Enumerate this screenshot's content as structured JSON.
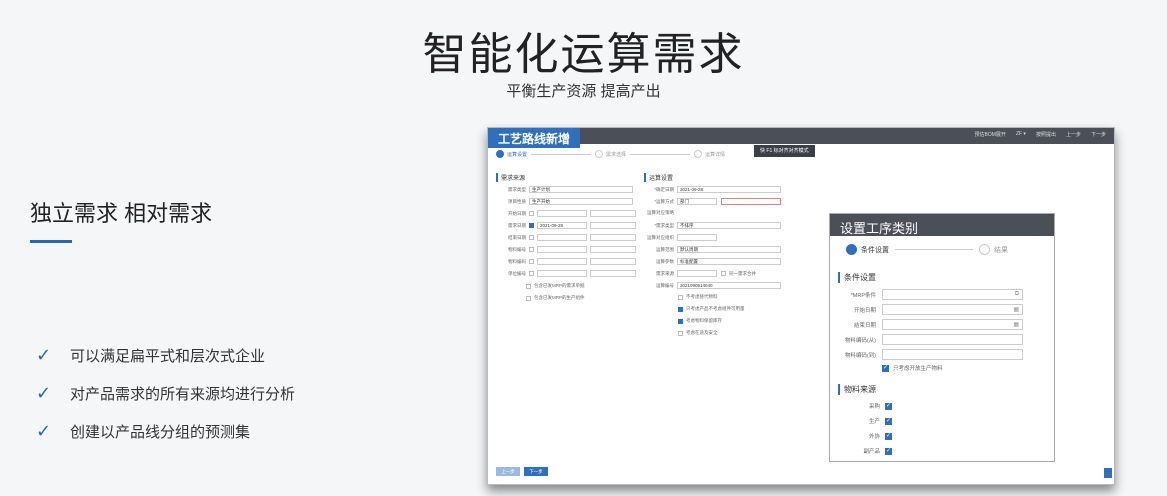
{
  "hero": {
    "title": "智能化运算需求",
    "subtitle": "平衡生产资源 提高产出"
  },
  "left": {
    "heading": "独立需求 相对需求",
    "features": [
      "可以满足扁平式和层次式企业",
      "对产品需求的所有来源均进行分析",
      "创建以产品线分组的预测集"
    ]
  },
  "app": {
    "title": "工艺路线新增",
    "topbar": [
      "预估BOM展开",
      "ZF ▾",
      "按照提出",
      "上一步",
      "下一步"
    ],
    "mode_popup": "快  F1  标对齐对齐模式",
    "steps": [
      "运算设置",
      "需求选择",
      "运算详情"
    ],
    "left_section": "需求来源",
    "left_fields": [
      {
        "label": "需求类型",
        "value": "生产计划"
      },
      {
        "label": "项目性质",
        "value": "生产开始"
      },
      {
        "label": "开始日期",
        "value": ""
      },
      {
        "label": "需求日期",
        "value": "2021-09-28"
      },
      {
        "label": "结束日期",
        "value": ""
      },
      {
        "label": "物料编号",
        "value": ""
      },
      {
        "label": "物料编码",
        "value": ""
      },
      {
        "label": "单位编号",
        "value": ""
      }
    ],
    "left_checks": [
      "包含已发MRP的需求单据",
      "包含已发MRP的生产组件"
    ],
    "right_section": "运算设置",
    "right_fields": [
      {
        "label": "*确定日期",
        "value": "2021-09-28"
      },
      {
        "label": "*运算方式",
        "value": "部门"
      },
      {
        "label": "运算对应策略",
        "value": ""
      },
      {
        "label": "*需求类型",
        "value": "不排序"
      },
      {
        "label": "运算对应组织",
        "value": ""
      },
      {
        "label": "运算范围",
        "value": "默认周期"
      },
      {
        "label": "运算参数",
        "value": "标准配置"
      },
      {
        "label": "需求来源",
        "value": ""
      },
      {
        "label": "运算编号",
        "value": "2021090514040"
      }
    ],
    "right_checks": [
      {
        "label": "不考虑替代物料",
        "on": false
      },
      {
        "label": "只考虑产品不考虑组件可用量",
        "on": true
      },
      {
        "label": "考虑物料保留库存",
        "on": true
      },
      {
        "label": "考虑在途及安全",
        "on": false
      }
    ],
    "extra_check": "同一需求合并",
    "bottom_buttons": [
      "上一步",
      "下一步"
    ]
  },
  "modal": {
    "title": "设置工序类别",
    "steps": [
      "条件设置",
      "结果"
    ],
    "section1": "条件设置",
    "fields": [
      {
        "label": "*MRP条件",
        "icon": "copy-icon"
      },
      {
        "label": "开始日期",
        "icon": "calendar-icon"
      },
      {
        "label": "结束日期",
        "icon": "calendar-icon"
      },
      {
        "label": "物料编码(从)",
        "icon": ""
      },
      {
        "label": "物料编码(到)",
        "icon": ""
      }
    ],
    "include_check": "只考虑开放生产物料",
    "section2": "物料来源",
    "sources": [
      "采购",
      "生产",
      "外协",
      "副产品"
    ]
  }
}
